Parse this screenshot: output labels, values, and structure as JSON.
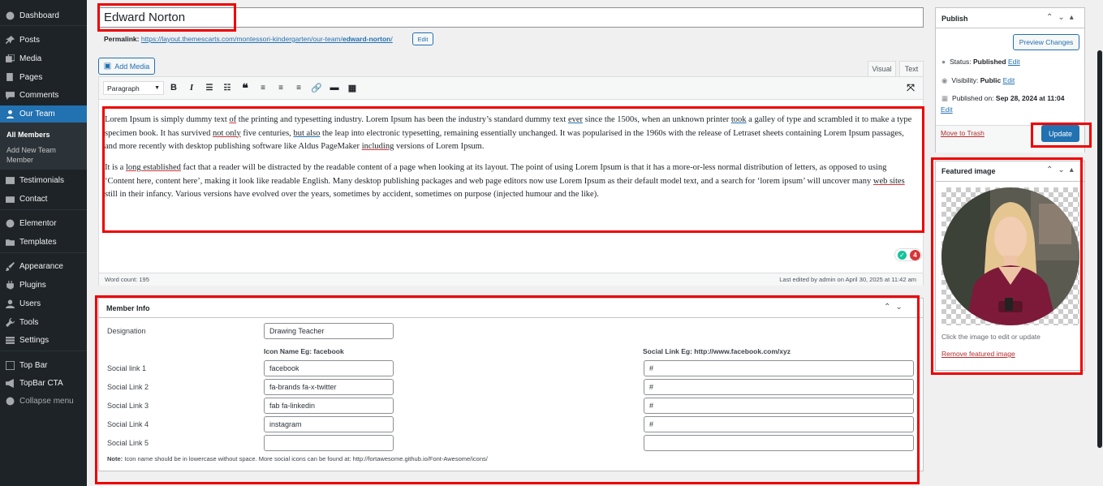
{
  "sidebar": {
    "items": [
      {
        "label": "Dashboard",
        "icon": "dashboard-icon"
      },
      {
        "label": "Posts",
        "icon": "pin-icon"
      },
      {
        "label": "Media",
        "icon": "media-icon"
      },
      {
        "label": "Pages",
        "icon": "pages-icon"
      },
      {
        "label": "Comments",
        "icon": "comments-icon"
      },
      {
        "label": "Our Team",
        "icon": "team-icon"
      },
      {
        "label": "Testimonials",
        "icon": "testimonial-icon"
      },
      {
        "label": "Contact",
        "icon": "mail-icon"
      },
      {
        "label": "Elementor",
        "icon": "elementor-icon"
      },
      {
        "label": "Templates",
        "icon": "folder-icon"
      },
      {
        "label": "Appearance",
        "icon": "brush-icon"
      },
      {
        "label": "Plugins",
        "icon": "plugin-icon"
      },
      {
        "label": "Users",
        "icon": "users-icon"
      },
      {
        "label": "Tools",
        "icon": "wrench-icon"
      },
      {
        "label": "Settings",
        "icon": "settings-icon"
      },
      {
        "label": "Top Bar",
        "icon": "topbar-icon"
      },
      {
        "label": "TopBar CTA",
        "icon": "megaphone-icon"
      },
      {
        "label": "Collapse menu",
        "icon": "collapse-icon"
      }
    ],
    "submenu": {
      "all_members": "All Members",
      "add_new_1": "Add New Team",
      "add_new_2": "Member"
    }
  },
  "editor": {
    "title": "Edward Norton",
    "permalink_label": "Permalink:",
    "permalink_base": "https://layout.themescarts.com/montessori-kindergarten/our-team/",
    "permalink_slug": "edward-norton",
    "permalink_end": "/",
    "permalink_edit": "Edit",
    "add_media": "Add Media",
    "tab_visual": "Visual",
    "tab_text": "Text",
    "format_select": "Paragraph",
    "p1": {
      "a": "Lorem Ipsum is simply dummy text ",
      "b": "of",
      "c": " the printing and typesetting industry. Lorem Ipsum has been the industry’s standard dummy text ",
      "d": "ever",
      "e": " since the 1500s, when an unknown printer ",
      "f": "took",
      "g": " a galley of type and scrambled it to make a type specimen book. It has survived ",
      "h": "not only",
      "i": " five centuries, ",
      "j": "but also",
      "k": " the leap into electronic typesetting, remaining essentially unchanged. It was popularised in the 1960s with the release of Letraset sheets containing Lorem Ipsum passages, and more recently with desktop publishing software like Aldus PageMaker ",
      "l": "including",
      "m": " versions of Lorem Ipsum."
    },
    "p2": {
      "a": "It is a ",
      "b": "long established",
      "c": " fact that a reader will be distracted by the readable content of a page when looking at its layout. The point of using Lorem Ipsum is that it has a more-or-less normal distribution of letters, as opposed to using ‘Content here, content here’, making it look like readable English. Many desktop publishing packages and web page editors now use Lorem Ipsum as their default model text, and a search for ‘lorem ipsum’ will uncover many ",
      "d": "web sites",
      "e": " still in their infancy. Various versions have evolved over the years, sometimes by accident, sometimes on purpose (injected humour and the like)."
    },
    "badge_count": "4",
    "word_count": "Word count: 195",
    "last_edited": "Last edited by admin on April 30, 2025 at 11:42 am"
  },
  "member_info": {
    "title": "Member Info",
    "designation_label": "Designation",
    "designation_value": "Drawing Teacher",
    "icon_header": "Icon Name Eg: facebook",
    "link_header": "Social Link Eg: http://www.facebook.com/xyz",
    "rows": [
      {
        "label": "Social link 1",
        "icon": "facebook",
        "link": "#"
      },
      {
        "label": "Social Link 2",
        "icon": "fa-brands fa-x-twitter",
        "link": "#"
      },
      {
        "label": "Social Link 3",
        "icon": "fab fa-linkedin",
        "link": "#"
      },
      {
        "label": "Social Link 4",
        "icon": "instagram",
        "link": "#"
      },
      {
        "label": "Social Link 5",
        "icon": "",
        "link": ""
      }
    ],
    "note_bold": "Note:",
    "note_text": " Icon name should be in lowercase without space. More social icons can be found at: http://fortawesome.github.io/Font-Awesome/icons/"
  },
  "publish": {
    "title": "Publish",
    "preview": "Preview Changes",
    "status_label": "Status: ",
    "status_value": "Published",
    "visibility_label": "Visibility: ",
    "visibility_value": "Public",
    "published_label": "Published on: ",
    "published_value": "Sep 28, 2024 at 11:04",
    "edit": "Edit",
    "trash": "Move to Trash",
    "update": "Update"
  },
  "featured": {
    "title": "Featured image",
    "hint": "Click the image to edit or update",
    "remove": "Remove featured image"
  },
  "colors": {
    "accent": "#2271b1",
    "sidebar": "#1d2327",
    "highlight_box": "#e00000",
    "badge": "#d63638"
  }
}
